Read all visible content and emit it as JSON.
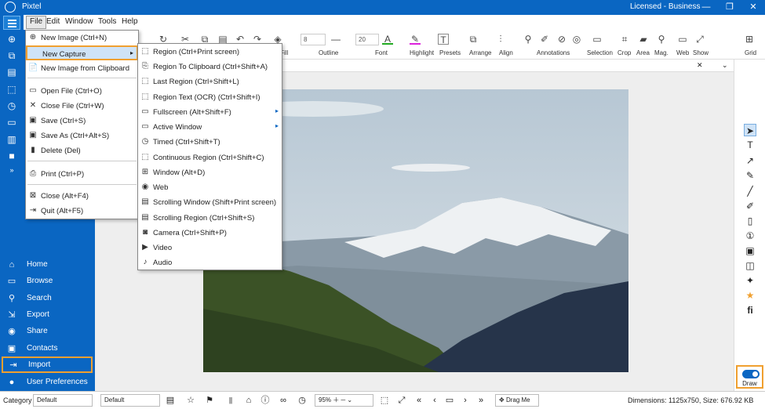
{
  "title_bar": {
    "app": "Pixtel",
    "license": "Licensed - Business",
    "min": "—",
    "max": "❐",
    "close": "✕"
  },
  "menubar": [
    "File",
    "Edit",
    "Window",
    "Tools",
    "Help"
  ],
  "ribbon": {
    "fill": "Fill",
    "outline": "Outline",
    "font": "Font",
    "highlight": "Highlight",
    "presets": "Presets",
    "arrange": "Arrange",
    "align": "Align",
    "annotations": "Annotations",
    "selection": "Selection",
    "crop": "Crop",
    "area": "Area",
    "mag": "Mag.",
    "web": "Web",
    "show": "Show",
    "grid": "Grid",
    "outline_width": "8",
    "font_size": "20"
  },
  "nav": [
    {
      "label": "Home",
      "icon": "home-icon"
    },
    {
      "label": "Browse",
      "icon": "browse-icon"
    },
    {
      "label": "Search",
      "icon": "search-icon"
    },
    {
      "label": "Export",
      "icon": "export-icon"
    },
    {
      "label": "Share",
      "icon": "share-icon"
    },
    {
      "label": "Contacts",
      "icon": "contacts-icon"
    },
    {
      "label": "Import",
      "icon": "import-icon"
    },
    {
      "label": "User Preferences",
      "icon": "user-icon"
    }
  ],
  "file_menu": [
    {
      "label": "New Image (Ctrl+N)",
      "icon": "⊕"
    },
    {
      "label": "New Capture",
      "icon": "",
      "arrow": "▸"
    },
    {
      "label": "New Image from Clipboard",
      "icon": "📄"
    },
    {
      "label": "Open File (Ctrl+O)",
      "icon": "▭"
    },
    {
      "label": "Close File (Ctrl+W)",
      "icon": "✕"
    },
    {
      "label": "Save (Ctrl+S)",
      "icon": "▣"
    },
    {
      "label": "Save As (Ctrl+Alt+S)",
      "icon": "▣"
    },
    {
      "label": "Delete (Del)",
      "icon": "▮"
    },
    {
      "label": "Print (Ctrl+P)",
      "icon": "⎙"
    },
    {
      "label": "Close (Alt+F4)",
      "icon": "⊠"
    },
    {
      "label": "Quit (Alt+F5)",
      "icon": "⇥"
    }
  ],
  "capture_menu": [
    {
      "label": "Region (Ctrl+Print screen)",
      "icon": "⬚"
    },
    {
      "label": "Region To Clipboard (Ctrl+Shift+A)",
      "icon": "⎘"
    },
    {
      "label": "Last Region (Ctrl+Shift+L)",
      "icon": "⬚"
    },
    {
      "label": "Region Text (OCR) (Ctrl+Shift+I)",
      "icon": "⬚"
    },
    {
      "label": "Fullscreen (Alt+Shift+F)",
      "icon": "▭",
      "arrow": "▸"
    },
    {
      "label": "Active Window",
      "icon": "▭",
      "arrow": "▸"
    },
    {
      "label": "Timed (Ctrl+Shift+T)",
      "icon": "◷"
    },
    {
      "label": "Continuous Region (Ctrl+Shift+C)",
      "icon": "⬚"
    },
    {
      "label": "Window (Alt+D)",
      "icon": "⊞"
    },
    {
      "label": "Web",
      "icon": "◉"
    },
    {
      "label": "Scrolling Window (Shift+Print screen)",
      "icon": "▤"
    },
    {
      "label": "Scrolling Region (Ctrl+Shift+S)",
      "icon": "▤"
    },
    {
      "label": "Camera (Ctrl+Shift+P)",
      "icon": "◙"
    },
    {
      "label": "Video",
      "icon": "▶"
    },
    {
      "label": "Audio",
      "icon": "♪"
    }
  ],
  "status": {
    "category_label": "Category",
    "category": "Default",
    "tag": "Default",
    "zoom": "95%",
    "drag": "Drag Me",
    "dims": "Dimensions: 1125x750, Size: 676.92 KB",
    "draw": "Draw"
  }
}
